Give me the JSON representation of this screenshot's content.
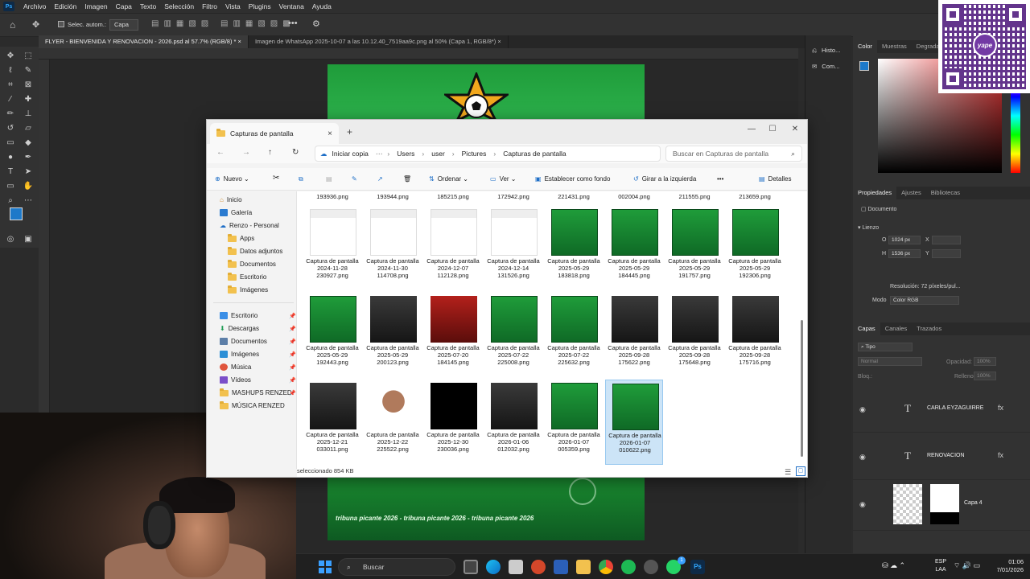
{
  "photoshop": {
    "logo": "Ps",
    "menu": [
      "Archivo",
      "Edición",
      "Imagen",
      "Capa",
      "Texto",
      "Selección",
      "Filtro",
      "Vista",
      "Plugins",
      "Ventana",
      "Ayuda"
    ],
    "options": {
      "auto_select": "Selec. autom.:",
      "layer_select": "Capa"
    },
    "doc_tabs": [
      "FLYER - BIENVENIDA Y RENOVACION - 2026.psd al 57.7% (RGB/8) *",
      "Imagen de WhatsApp 2025-10-07 a las 10.12.40_7519aa9c.png al 50% (Capa 1, RGB/8*)"
    ],
    "side_panels": [
      "Histo...",
      "Com..."
    ],
    "color_tabs": [
      "Color",
      "Muestras",
      "Degradados"
    ],
    "properties": {
      "tabs": [
        "Propiedades",
        "Ajustes",
        "Bibliotecas"
      ],
      "doc_label": "Documento",
      "canvas_label": "Lienzo",
      "w_label": "O",
      "w_value": "1024 px",
      "x_label": "X",
      "h_label": "H",
      "h_value": "1536 px",
      "y_label": "Y",
      "resolution": "Resolución: 72 píxeles/pul...",
      "mode_label": "Modo",
      "mode_value": "Color RGB"
    },
    "layers": {
      "tabs": [
        "Capas",
        "Canales",
        "Trazados"
      ],
      "filter": "Tipo",
      "blend": "Normal",
      "opacity_label": "Opacidad:",
      "opacity_value": "100%",
      "lock_label": "Bloq.:",
      "fill_label": "Relleno:",
      "fill_value": "100%",
      "items": [
        {
          "name": "CARLA EYZAGUIRRE",
          "type": "T"
        },
        {
          "name": "RENOVACION",
          "type": "T"
        },
        {
          "name": "Capa 4",
          "type": "image"
        }
      ]
    },
    "canvas_promo": "tribuna picante 2026 - tribuna picante 2026 - tribuna picante 2026"
  },
  "qr": {
    "badge": "yape"
  },
  "explorer": {
    "tab_title": "Capturas de pantalla",
    "address": {
      "start": "Iniciar copia",
      "crumbs": [
        "Users",
        "user",
        "Pictures",
        "Capturas de pantalla"
      ]
    },
    "search_placeholder": "Buscar en Capturas de pantalla",
    "commands": {
      "new": "Nuevo",
      "sort": "Ordenar",
      "view": "Ver",
      "set_bg": "Establecer como fondo",
      "rotate": "Girar a la izquierda",
      "details": "Detalles"
    },
    "nav_top": [
      "Inicio",
      "Galería",
      "Renzo - Personal"
    ],
    "nav_folders": [
      "Apps",
      "Datos adjuntos",
      "Documentos",
      "Escritorio",
      "Imágenes"
    ],
    "nav_quick": [
      "Escritorio",
      "Descargas",
      "Documentos",
      "Imágenes",
      "Música",
      "Vídeos",
      "MASHUPS RENZED",
      "MÚSICA RENZED"
    ],
    "top_row_partial": [
      "193936.png",
      "193944.png",
      "185215.png",
      "172942.png",
      "221431.png",
      "002004.png",
      "211555.png",
      "213659.png"
    ],
    "files": [
      {
        "label": "Captura de pantalla 2024-11-28 230927.png",
        "thumb": "doc"
      },
      {
        "label": "Captura de pantalla 2024-11-30 114708.png",
        "thumb": "doc"
      },
      {
        "label": "Captura de pantalla 2024-12-07 112128.png",
        "thumb": "doc"
      },
      {
        "label": "Captura de pantalla 2024-12-14 131526.png",
        "thumb": "doc"
      },
      {
        "label": "Captura de pantalla 2025-05-29 183818.png",
        "thumb": "green"
      },
      {
        "label": "Captura de pantalla 2025-05-29 184445.png",
        "thumb": "green"
      },
      {
        "label": "Captura de pantalla 2025-05-29 191757.png",
        "thumb": "green"
      },
      {
        "label": "Captura de pantalla 2025-05-29 192306.png",
        "thumb": "green"
      },
      {
        "label": "Captura de pantalla 2025-05-29 192443.png",
        "thumb": "green"
      },
      {
        "label": "Captura de pantalla 2025-05-29 200123.png",
        "thumb": "dark"
      },
      {
        "label": "Captura de pantalla 2025-07-20 184145.png",
        "thumb": "red"
      },
      {
        "label": "Captura de pantalla 2025-07-22 225008.png",
        "thumb": "green"
      },
      {
        "label": "Captura de pantalla 2025-07-22 225632.png",
        "thumb": "green"
      },
      {
        "label": "Captura de pantalla 2025-09-28 175622.png",
        "thumb": "dark"
      },
      {
        "label": "Captura de pantalla 2025-09-28 175648.png",
        "thumb": "dark"
      },
      {
        "label": "Captura de pantalla 2025-09-28 175716.png",
        "thumb": "dark"
      },
      {
        "label": "Captura de pantalla 2025-12-21 033011.png",
        "thumb": "dark"
      },
      {
        "label": "Captura de pantalla 2025-12-22 225522.png",
        "thumb": "person"
      },
      {
        "label": "Captura de pantalla 2025-12-30 230036.png",
        "thumb": "black"
      },
      {
        "label": "Captura de pantalla 2026-01-06 012032.png",
        "thumb": "dark"
      },
      {
        "label": "Captura de pantalla 2026-01-07 005359.png",
        "thumb": "green"
      },
      {
        "label": "Captura de pantalla 2026-01-07 010622.png",
        "thumb": "green",
        "selected": true
      }
    ],
    "status": "seleccionado  854 KB"
  },
  "taskbar": {
    "search": "Buscar",
    "lang1": "ESP",
    "lang2": "LAA",
    "time": "01:06",
    "date": "7/01/2026",
    "badge": "1"
  },
  "colors": {
    "ps_accent": "#31a8ff",
    "selection": "#cce4f7",
    "explorer_bg": "#f3f3f3"
  }
}
